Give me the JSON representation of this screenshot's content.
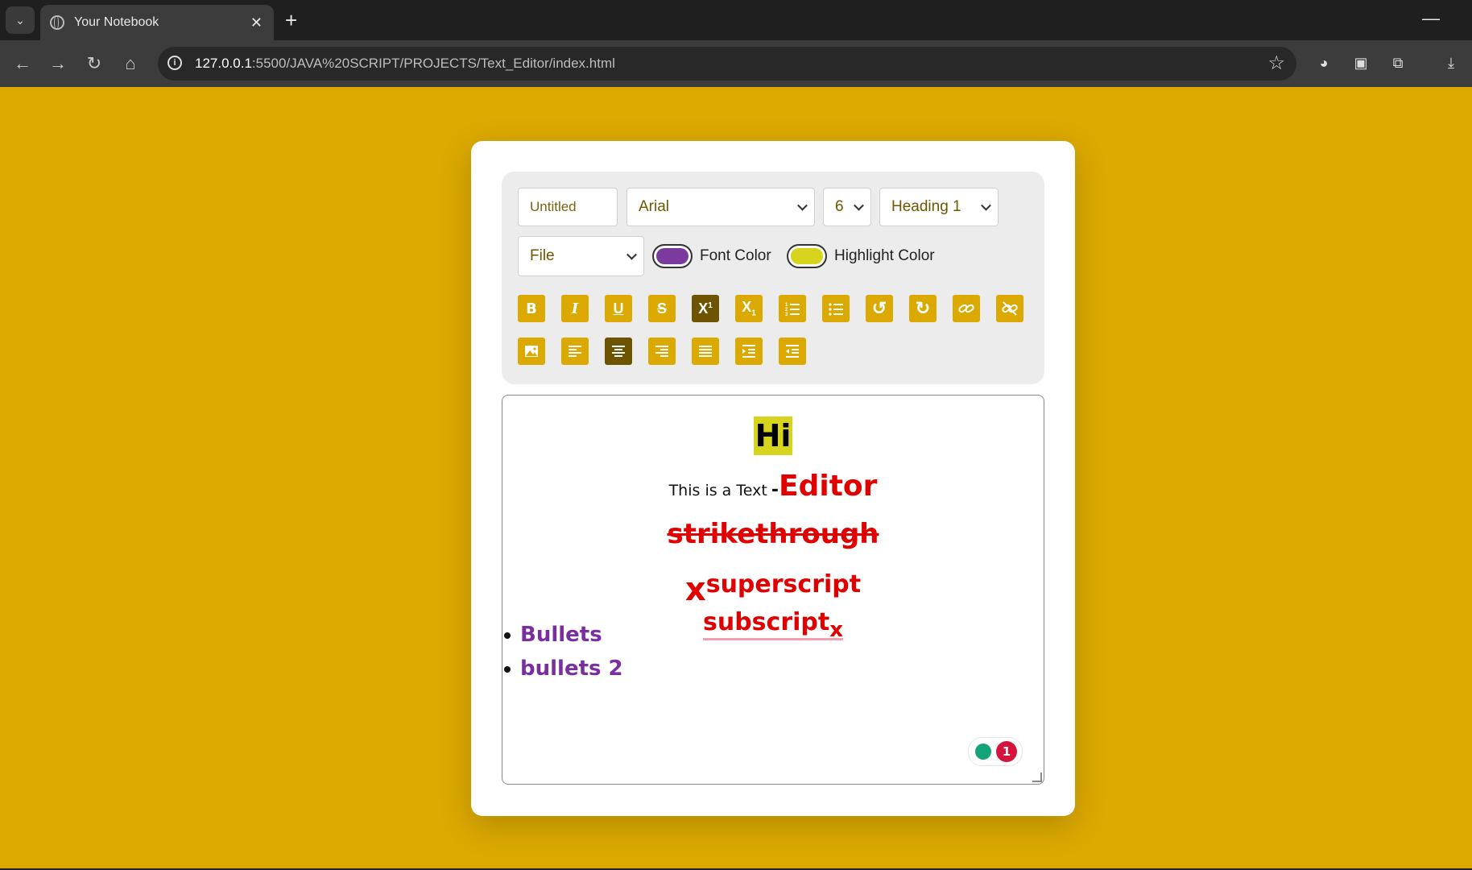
{
  "browser": {
    "tab_title": "Your Notebook",
    "url_host": "127.0.0.1",
    "url_path": ":5500/JAVA%20SCRIPT/PROJECTS/Text_Editor/index.html"
  },
  "toolbar": {
    "title_placeholder": "Untitled",
    "font_family": "Arial",
    "font_size": "6",
    "heading": "Heading 1",
    "file_menu": "File",
    "font_color_label": "Font Color",
    "highlight_color_label": "Highlight Color",
    "font_color": "#7a3a9e",
    "highlight_color": "#d6d41c",
    "button_color": "#dba900",
    "active_button_color": "#6e5300"
  },
  "editor": {
    "heading": "Hi",
    "line2_plain": "This is a Text",
    "line2_dash": "-",
    "line2_big": "Editor",
    "strike": "strikethrough",
    "super_base": "x",
    "super_text": "superscript",
    "sub_text": "subscript",
    "sub_base": "x",
    "bullets": [
      "Bullets",
      "bullets 2"
    ],
    "grammar_count": "1"
  }
}
